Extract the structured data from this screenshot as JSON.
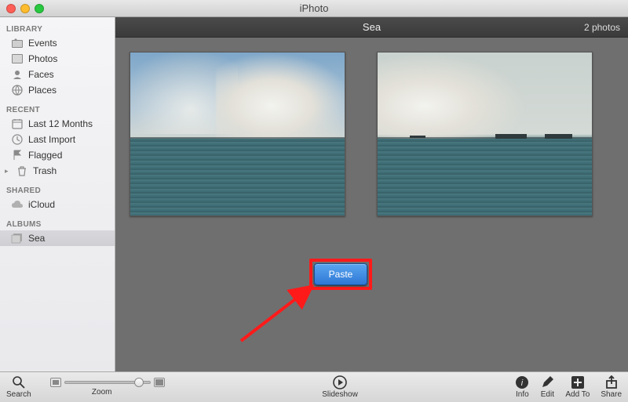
{
  "window": {
    "title": "iPhoto"
  },
  "sidebar": {
    "sections": [
      {
        "header": "LIBRARY",
        "items": [
          {
            "icon": "events",
            "label": "Events"
          },
          {
            "icon": "photos",
            "label": "Photos"
          },
          {
            "icon": "faces",
            "label": "Faces"
          },
          {
            "icon": "places",
            "label": "Places"
          }
        ]
      },
      {
        "header": "RECENT",
        "items": [
          {
            "icon": "calendar",
            "label": "Last 12 Months"
          },
          {
            "icon": "clock",
            "label": "Last Import"
          },
          {
            "icon": "flag",
            "label": "Flagged"
          },
          {
            "icon": "trash",
            "label": "Trash",
            "isTrash": true
          }
        ]
      },
      {
        "header": "SHARED",
        "items": [
          {
            "icon": "cloud",
            "label": "iCloud"
          }
        ]
      },
      {
        "header": "ALBUMS",
        "items": [
          {
            "icon": "album",
            "label": "Sea",
            "selected": true
          }
        ]
      }
    ]
  },
  "main": {
    "title": "Sea",
    "countLabel": "2 photos"
  },
  "context": {
    "pasteLabel": "Paste"
  },
  "toolbar": {
    "search": "Search",
    "zoom": "Zoom",
    "slideshow": "Slideshow",
    "info": "Info",
    "edit": "Edit",
    "addTo": "Add To",
    "share": "Share"
  }
}
